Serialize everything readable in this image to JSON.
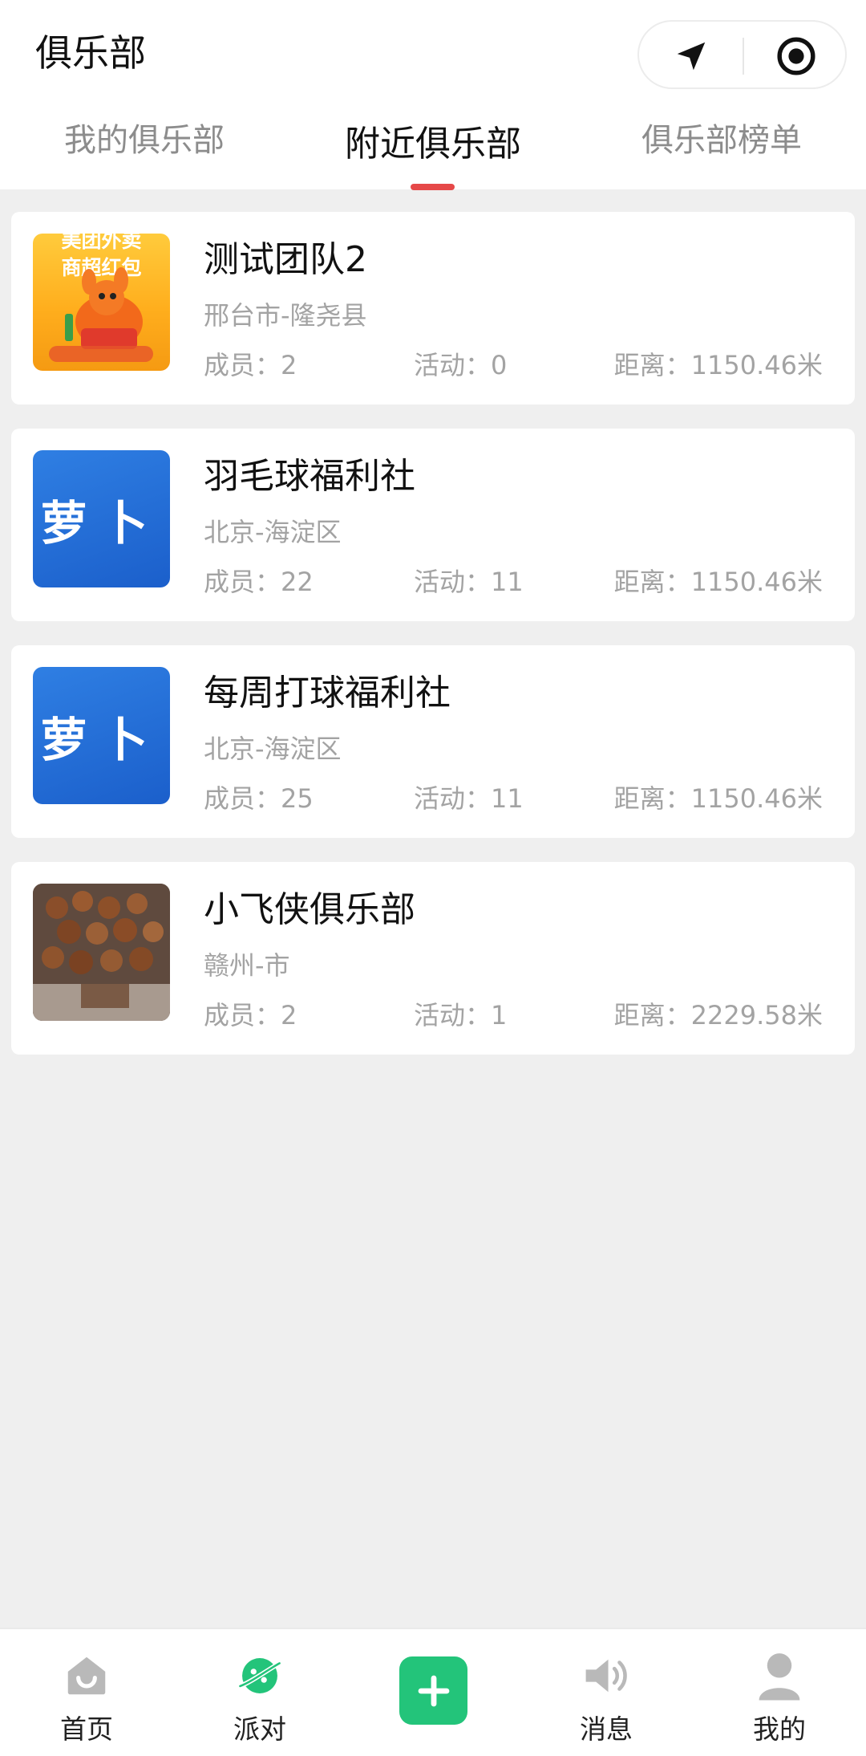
{
  "header": {
    "title": "俱乐部",
    "capsule": {
      "left_icon": "navigation-arrow-icon",
      "right_icon": "target-circle-icon"
    }
  },
  "tabs": [
    {
      "label": "我的俱乐部",
      "active": false
    },
    {
      "label": "附近俱乐部",
      "active": true
    },
    {
      "label": "俱乐部榜单",
      "active": false
    }
  ],
  "colors": {
    "accent_red": "#e64848",
    "brand_green": "#23c47a",
    "muted_text": "#a3a3a3",
    "logo_blue": "#1b5fcb"
  },
  "clubs": [
    {
      "name": "测试团队2",
      "location": "邢台市-隆尧县",
      "members": "成员：2",
      "activities": "活动：0",
      "distance": "距离：1150.46米",
      "thumb": {
        "type": "promo",
        "line1": "美团外卖",
        "line2": "商超红包"
      }
    },
    {
      "name": "羽毛球福利社",
      "location": "北京-海淀区",
      "members": "成员：22",
      "activities": "活动：11",
      "distance": "距离：1150.46米",
      "thumb": {
        "type": "logo",
        "text": "萝卜"
      }
    },
    {
      "name": "每周打球福利社",
      "location": "北京-海淀区",
      "members": "成员：25",
      "activities": "活动：11",
      "distance": "距离：1150.46米",
      "thumb": {
        "type": "logo",
        "text": "萝卜"
      }
    },
    {
      "name": "小飞侠俱乐部",
      "location": "赣州-市",
      "members": "成员：2",
      "activities": "活动：1",
      "distance": "距离：2229.58米",
      "thumb": {
        "type": "photo",
        "subject": "chestnuts"
      }
    }
  ],
  "bottom_nav": [
    {
      "label": "首页",
      "icon": "home-icon"
    },
    {
      "label": "派对",
      "icon": "party-icon"
    },
    {
      "label": "",
      "icon": "add-icon"
    },
    {
      "label": "消息",
      "icon": "speaker-icon"
    },
    {
      "label": "我的",
      "icon": "user-icon"
    }
  ]
}
